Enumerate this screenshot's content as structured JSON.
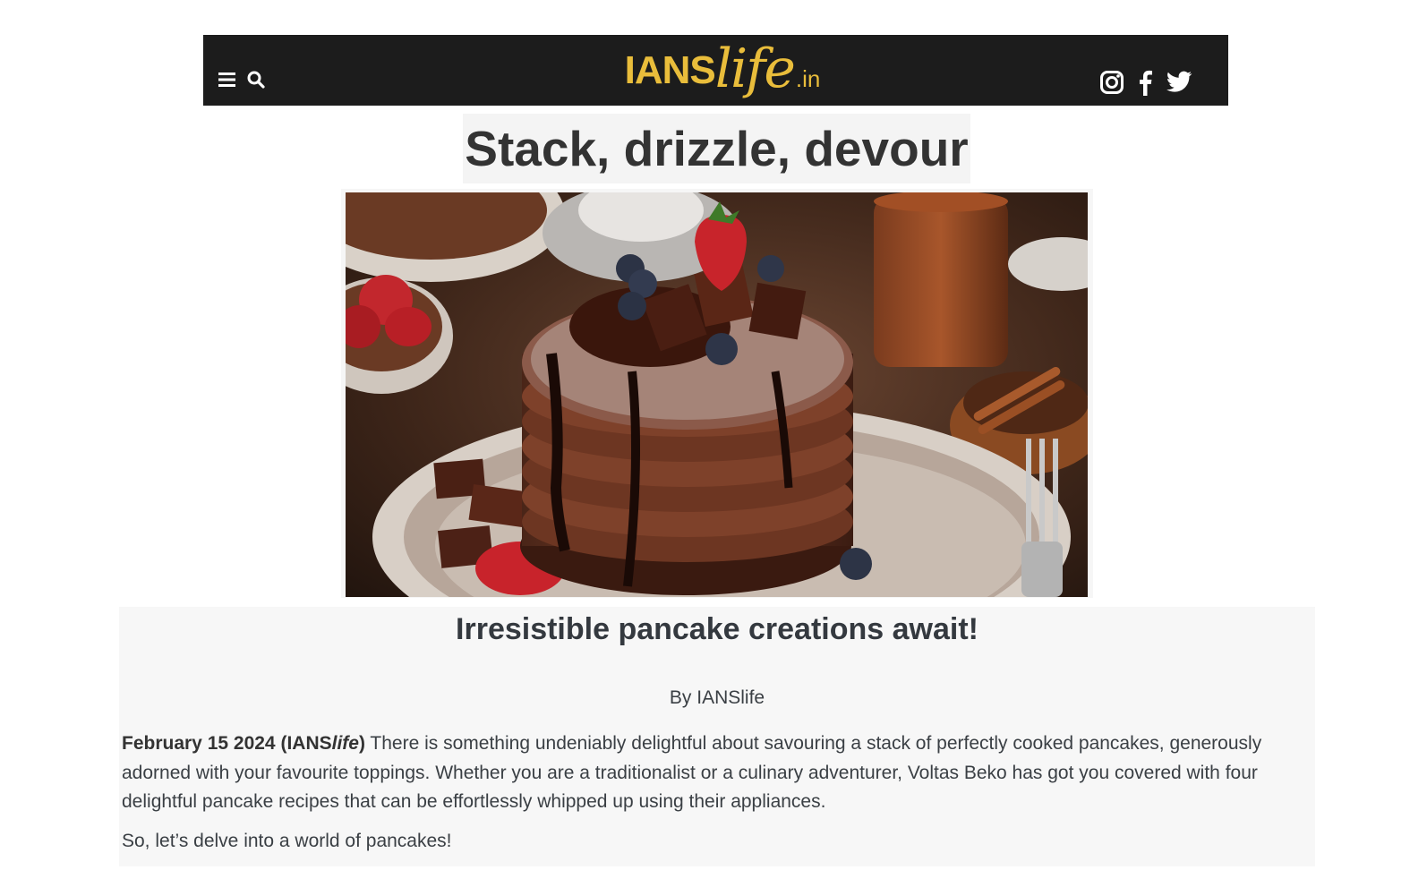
{
  "header": {
    "logo": {
      "main": "IANS",
      "script": "life",
      "suffix": ".in"
    },
    "icons": [
      "menu-icon",
      "search-icon",
      "instagram-icon",
      "facebook-icon",
      "twitter-icon"
    ]
  },
  "article": {
    "title": "Stack, drizzle, devour",
    "subtitle": "Irresistible pancake creations await!",
    "byline": "By IANSlife",
    "dateline_date": "February 15 2024",
    "dateline_source_prefix": "(IANS",
    "dateline_source_italic": "life",
    "dateline_source_suffix": ")",
    "intro": " There is something undeniably delightful about savouring a stack of perfectly cooked pancakes, generously adorned with your favourite toppings. Whether you are a traditionalist or a culinary adventurer, Voltas Beko has got you covered with four delightful pancake recipes that can be effortlessly whipped up using their appliances.",
    "second_paragraph": "So, let’s delve into a world of pancakes!"
  },
  "colors": {
    "header_bg": "#1c1c1c",
    "logo": "#e9bd3b",
    "title_bg": "#f4f4f4",
    "content_bg": "#f7f7f7",
    "text": "#3a3f44"
  }
}
